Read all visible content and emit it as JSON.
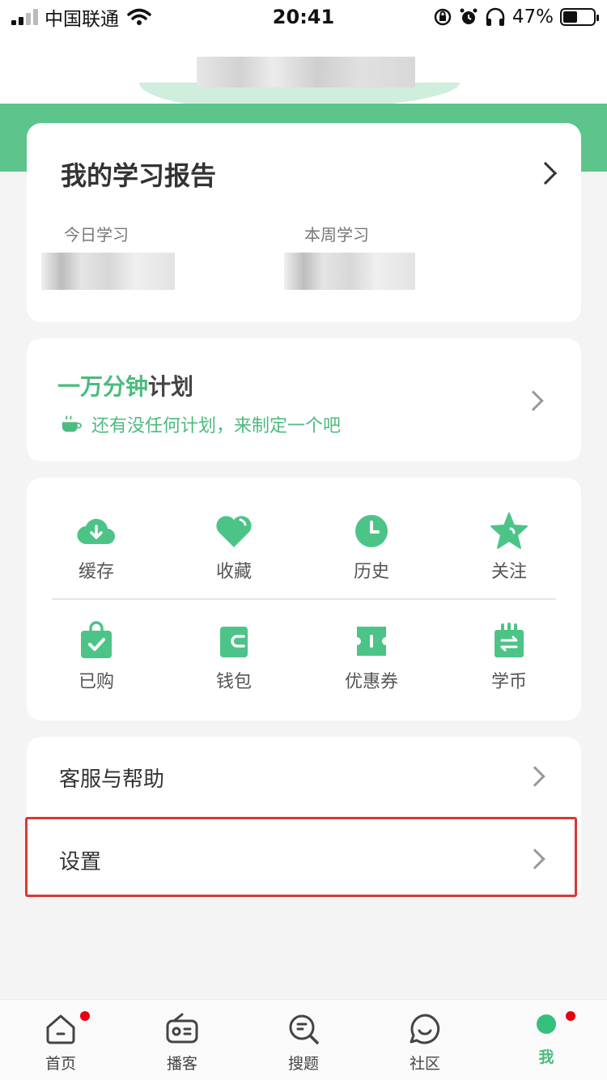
{
  "status_bar": {
    "carrier": "中国联通",
    "time": "20:41",
    "battery": "47%",
    "battery_level": 0.47
  },
  "report": {
    "title": "我的学习报告",
    "today_label": "今日学习",
    "week_label": "本周学习"
  },
  "plan": {
    "title_green": "一万分钟",
    "title_dark": "计划",
    "subtitle": "还有没任何计划，来制定一个吧"
  },
  "shortcuts": [
    {
      "label": "缓存",
      "icon": "cloud-download-icon"
    },
    {
      "label": "收藏",
      "icon": "heart-icon"
    },
    {
      "label": "历史",
      "icon": "clock-icon"
    },
    {
      "label": "关注",
      "icon": "star-icon"
    },
    {
      "label": "已购",
      "icon": "shopping-bag-check-icon"
    },
    {
      "label": "钱包",
      "icon": "wallet-icon"
    },
    {
      "label": "优惠券",
      "icon": "coupon-icon"
    },
    {
      "label": "学币",
      "icon": "coin-exchange-icon"
    }
  ],
  "menu": {
    "help": "客服与帮助",
    "settings": "设置"
  },
  "tabs": [
    {
      "label": "首页",
      "icon": "home-icon",
      "badge": true
    },
    {
      "label": "播客",
      "icon": "radio-icon",
      "badge": false
    },
    {
      "label": "搜题",
      "icon": "search-question-icon",
      "badge": false
    },
    {
      "label": "社区",
      "icon": "chat-smile-icon",
      "badge": false
    },
    {
      "label": "我",
      "icon": "me-icon",
      "badge": true,
      "active": true
    }
  ],
  "colors": {
    "brand_green": "#5dc48b",
    "accent_green": "#4cbb7f",
    "highlight_red": "#d73a32",
    "badge_red": "#e60012"
  }
}
